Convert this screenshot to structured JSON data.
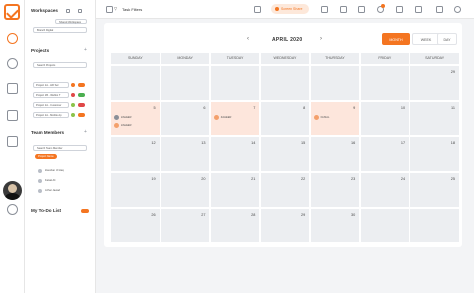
{
  "sidebar": {
    "workspaces_title": "Workspaces",
    "shared_workspace": "Shared Workspace",
    "branch_digital": "Branch Digital",
    "projects_title": "Projects",
    "search_projects_placeholder": "Search Projects",
    "projects": [
      {
        "label": "Project 1A - HR Sel"
      },
      {
        "label": "Project 1B - Weblio T"
      },
      {
        "label": "Project 1A - Customer"
      },
      {
        "label": "Project 1A - Mobile Ap"
      }
    ],
    "team_title": "Team Members",
    "search_team_placeholder": "Search Team Member",
    "project_name_tag": "Project Name",
    "members": [
      {
        "name": "Zeeshan Ul Haq"
      },
      {
        "name": "Faisal Ali"
      },
      {
        "name": "Azhar Jawad"
      }
    ],
    "todo_title": "My To-Do List"
  },
  "topbar": {
    "task_filters": "Task Filters",
    "screen_share": "Screen Share"
  },
  "calendar": {
    "month": "APRIL 2020",
    "views": [
      "MONTH",
      "WEEK",
      "DAY"
    ],
    "days": [
      "SUNDAY",
      "MONDAY",
      "TUESDAY",
      "WEDNESDAY",
      "THURSDAY",
      "FRIDAY",
      "SATURDAY"
    ],
    "weeks": [
      [
        "",
        "",
        "",
        "",
        "",
        "",
        ""
      ],
      [
        "",
        "",
        "",
        "",
        "",
        "",
        ""
      ],
      [
        "",
        "",
        "",
        "",
        "",
        "",
        ""
      ],
      [
        "",
        "",
        "",
        "",
        "",
        "",
        ""
      ],
      [
        "",
        "",
        "",
        "",
        "",
        "",
        ""
      ]
    ],
    "week_dates": [
      [
        "",
        "",
        "",
        "",
        "",
        "",
        ""
      ],
      [
        "",
        "",
        "",
        "",
        "",
        "",
        ""
      ],
      [
        "",
        "",
        "",
        "",
        "",
        "",
        ""
      ],
      [
        "",
        "",
        "",
        "",
        "",
        "",
        ""
      ],
      [
        "",
        "",
        "",
        "",
        "",
        "",
        ""
      ]
    ],
    "dates": [
      [
        "",
        "",
        "",
        "",
        "",
        "",
        "29"
      ],
      [
        "5",
        "6",
        "7",
        "8",
        "9",
        "10",
        "11"
      ],
      [
        "12",
        "13",
        "14",
        "15",
        "16",
        "17",
        "18"
      ],
      [
        "19",
        "20",
        "21",
        "22",
        "23",
        "24",
        "25"
      ],
      [
        "26",
        "27",
        "28",
        "29",
        "30",
        "",
        ""
      ]
    ],
    "events": {
      "sunday": [
        "ZAHEER",
        "ZAHEER"
      ],
      "tuesday": [
        "ZAHEER"
      ],
      "thursday": [
        "FAISAL"
      ]
    }
  }
}
